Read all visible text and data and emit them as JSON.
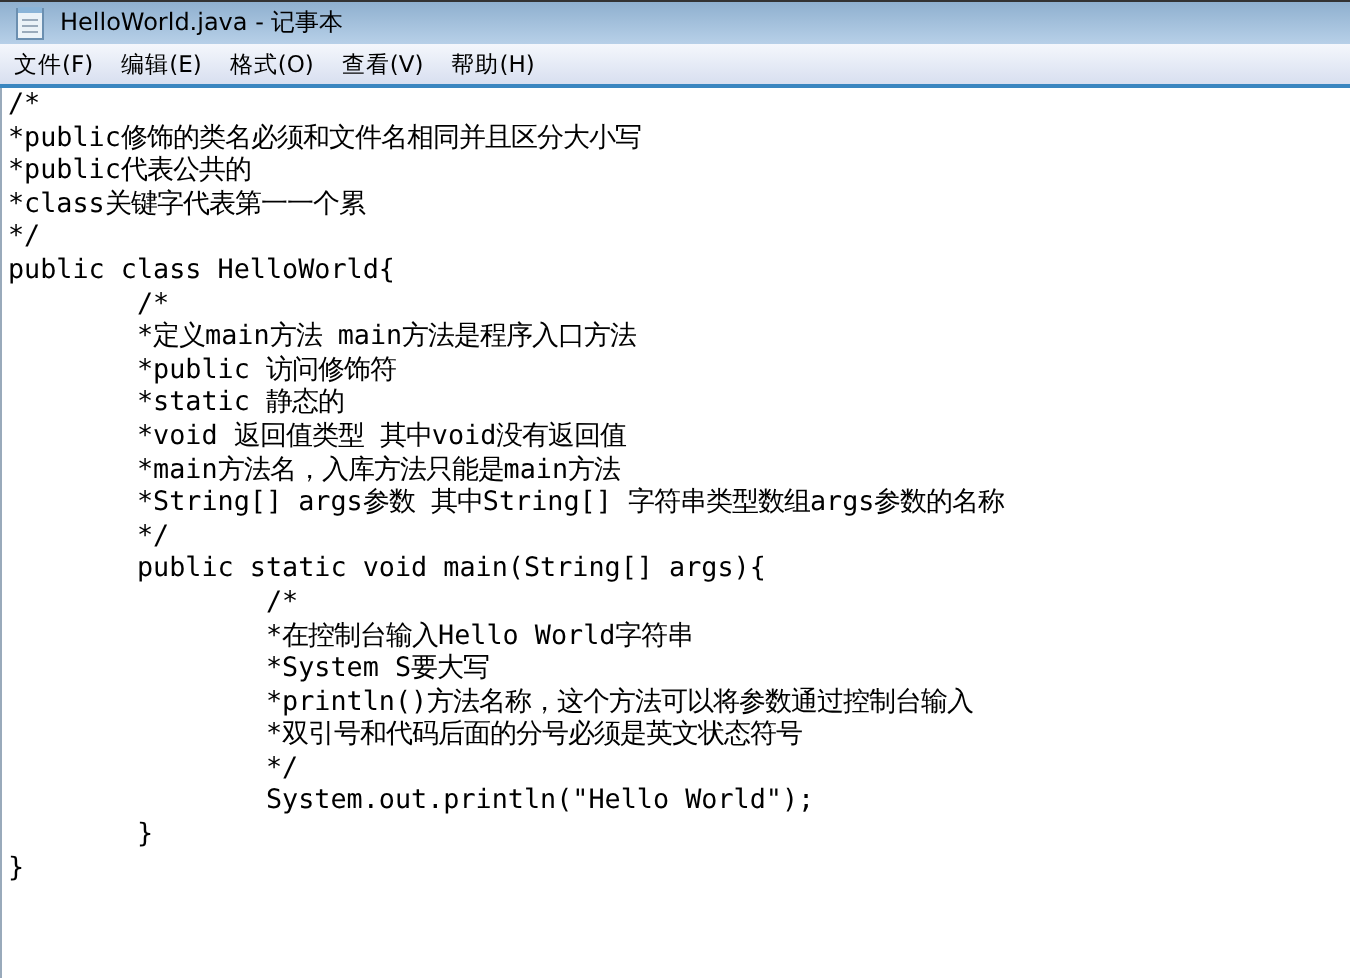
{
  "window": {
    "title": "HelloWorld.java - 记事本"
  },
  "menu": [
    "文件(F)",
    "编辑(E)",
    "格式(O)",
    "查看(V)",
    "帮助(H)"
  ],
  "editor": {
    "lines": [
      "/*",
      "*public修饰的类名必须和文件名相同并且区分大小写",
      "*public代表公共的",
      "*class关键字代表第一一个累",
      "*/",
      "public class HelloWorld{",
      "\t/*",
      "\t*定义main方法 main方法是程序入口方法",
      "\t*public 访问修饰符",
      "\t*static 静态的",
      "\t*void 返回值类型 其中void没有返回值",
      "\t*main方法名，入库方法只能是main方法",
      "\t*String[] args参数 其中String[] 字符串类型数组args参数的名称",
      "\t*/",
      "\tpublic static void main(String[] args){",
      "\t\t/*",
      "\t\t*在控制台输入Hello World字符串",
      "\t\t*System S要大写",
      "\t\t*println()方法名称，这个方法可以将参数通过控制台输入",
      "\t\t*双引号和代码后面的分号必须是英文状态符号",
      "\t\t*/",
      "\t\tSystem.out.println(\"Hello World\");",
      "\t}",
      "}"
    ]
  }
}
